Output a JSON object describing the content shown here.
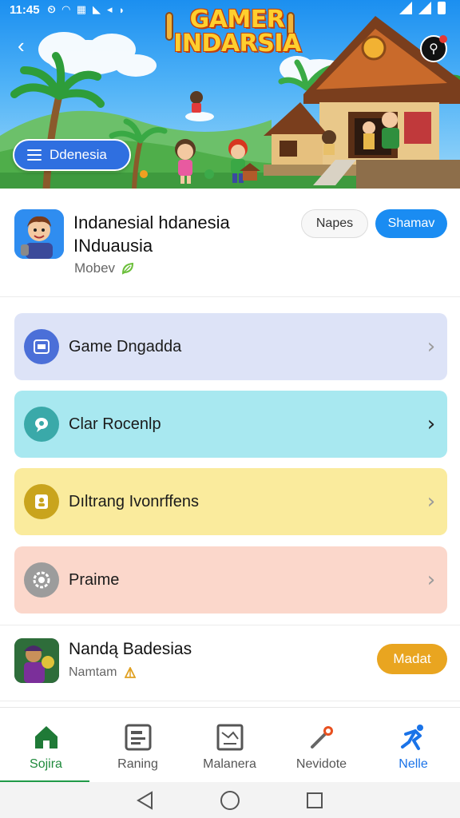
{
  "status_bar": {
    "time": "11:45"
  },
  "hero": {
    "title_line1": "GAMER",
    "title_line2": "INDARSIA",
    "region_label": "Ddenesia",
    "back_icon": "back-arrow-icon",
    "share_icon": "share-icon"
  },
  "app": {
    "title": "Indanesial hdanesia INduausia",
    "developer": "Mobev",
    "secondary_button": "Napes",
    "primary_button": "Shamav"
  },
  "menu": [
    {
      "label": "Game Dngadda",
      "icon": "gamepad-icon",
      "color": "#dde3f7",
      "icon_color": "#4b6fd8"
    },
    {
      "label": "Clar Rocenlp",
      "icon": "chat-bubble-icon",
      "color": "#a8e8f0",
      "icon_color": "#3aa9a9"
    },
    {
      "label": "Dıltrang Ivonrffens",
      "icon": "person-icon",
      "color": "#faeb9d",
      "icon_color": "#c9a41d"
    },
    {
      "label": "Praime",
      "icon": "gear-icon",
      "color": "#fbd7cb",
      "icon_color": "#9c9c9c"
    }
  ],
  "second_app": {
    "name": "Nandą Badesias",
    "developer": "Namtam",
    "button": "Madat"
  },
  "bottom_nav": [
    {
      "label": "Sojira",
      "icon": "home-icon"
    },
    {
      "label": "Raning",
      "icon": "list-icon"
    },
    {
      "label": "Malanera",
      "icon": "map-icon"
    },
    {
      "label": "Nevidote",
      "icon": "joystick-icon"
    },
    {
      "label": "Nelle",
      "icon": "runner-icon"
    }
  ],
  "colors": {
    "accent_blue": "#1a8cf2",
    "accent_green": "#1f9a47",
    "accent_orange": "#e9a520"
  }
}
